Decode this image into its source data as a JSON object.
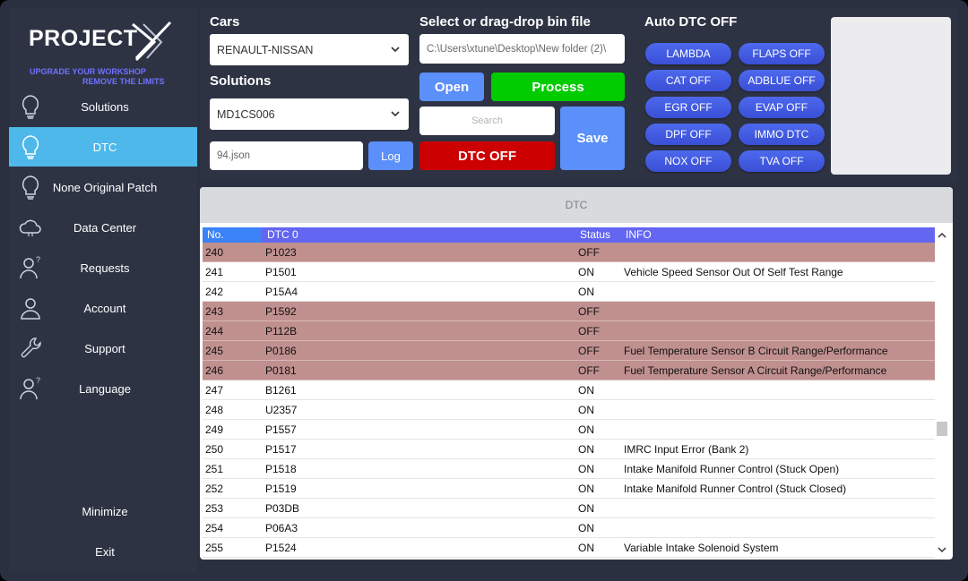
{
  "brand": {
    "name": "PROJECT",
    "tagline1": "UPGRADE YOUR WORKSHOP",
    "tagline2": "REMOVE THE LIMITS"
  },
  "sidebar": {
    "items": [
      {
        "label": "Solutions",
        "icon": "lightbulb-icon"
      },
      {
        "label": "DTC",
        "icon": "lightbulb-icon"
      },
      {
        "label": "None Original Patch",
        "icon": "lightbulb-icon"
      },
      {
        "label": "Data Center",
        "icon": "cloud-icon"
      },
      {
        "label": "Requests",
        "icon": "user-question-icon"
      },
      {
        "label": "Account",
        "icon": "user-icon"
      },
      {
        "label": "Support",
        "icon": "wrench-icon"
      },
      {
        "label": "Language",
        "icon": "user-question-icon"
      }
    ],
    "minimize": "Minimize",
    "exit": "Exit"
  },
  "top": {
    "cars_label": "Cars",
    "cars_value": "RENAULT-NISSAN",
    "solutions_label": "Solutions",
    "solutions_value": "MD1CS006",
    "json_value": "94.json",
    "log_label": "Log",
    "file_label": "Select or drag-drop  bin file",
    "file_path": "C:\\Users\\xtune\\Desktop\\New folder (2)\\",
    "open_label": "Open",
    "process_label": "Process",
    "search_placeholder": "Search",
    "dtc_off_label": "DTC OFF",
    "save_label": "Save",
    "auto_label": "Auto DTC OFF",
    "auto_buttons": [
      "LAMBDA",
      "FLAPS OFF",
      "CAT OFF",
      "ADBLUE OFF",
      "EGR OFF",
      "EVAP OFF",
      "DPF OFF",
      "IMMO DTC",
      "NOX OFF",
      "TVA OFF"
    ]
  },
  "panel": {
    "title": "DTC",
    "columns": [
      "No.",
      "DTC 0",
      "Status",
      "INFO"
    ],
    "rows": [
      {
        "no": "240",
        "dtc": "P1023",
        "status": "OFF",
        "info": ""
      },
      {
        "no": "241",
        "dtc": "P1501",
        "status": "ON",
        "info": "Vehicle Speed Sensor Out Of Self Test Range"
      },
      {
        "no": "242",
        "dtc": "P15A4",
        "status": "ON",
        "info": ""
      },
      {
        "no": "243",
        "dtc": "P1592",
        "status": "OFF",
        "info": ""
      },
      {
        "no": "244",
        "dtc": "P112B",
        "status": "OFF",
        "info": ""
      },
      {
        "no": "245",
        "dtc": "P0186",
        "status": "OFF",
        "info": "Fuel Temperature Sensor B Circuit Range/Performance"
      },
      {
        "no": "246",
        "dtc": "P0181",
        "status": "OFF",
        "info": "Fuel Temperature Sensor A Circuit Range/Performance"
      },
      {
        "no": "247",
        "dtc": "B1261",
        "status": "ON",
        "info": ""
      },
      {
        "no": "248",
        "dtc": "U2357",
        "status": "ON",
        "info": ""
      },
      {
        "no": "249",
        "dtc": "P1557",
        "status": "ON",
        "info": ""
      },
      {
        "no": "250",
        "dtc": "P1517",
        "status": "ON",
        "info": "IMRC Input Error (Bank 2)"
      },
      {
        "no": "251",
        "dtc": "P1518",
        "status": "ON",
        "info": "Intake Manifold Runner Control (Stuck Open)"
      },
      {
        "no": "252",
        "dtc": "P1519",
        "status": "ON",
        "info": "Intake Manifold Runner Control (Stuck Closed)"
      },
      {
        "no": "253",
        "dtc": "P03DB",
        "status": "ON",
        "info": ""
      },
      {
        "no": "254",
        "dtc": "P06A3",
        "status": "ON",
        "info": ""
      },
      {
        "no": "255",
        "dtc": "P1524",
        "status": "ON",
        "info": "Variable Intake Solenoid System"
      }
    ]
  },
  "colors": {
    "accent": "#4eb8ea",
    "process": "#00cc00",
    "dtc_off": "#cc0000",
    "open": "#5b8ff9",
    "off_row": "#c0908f",
    "header": "#6366f1"
  }
}
